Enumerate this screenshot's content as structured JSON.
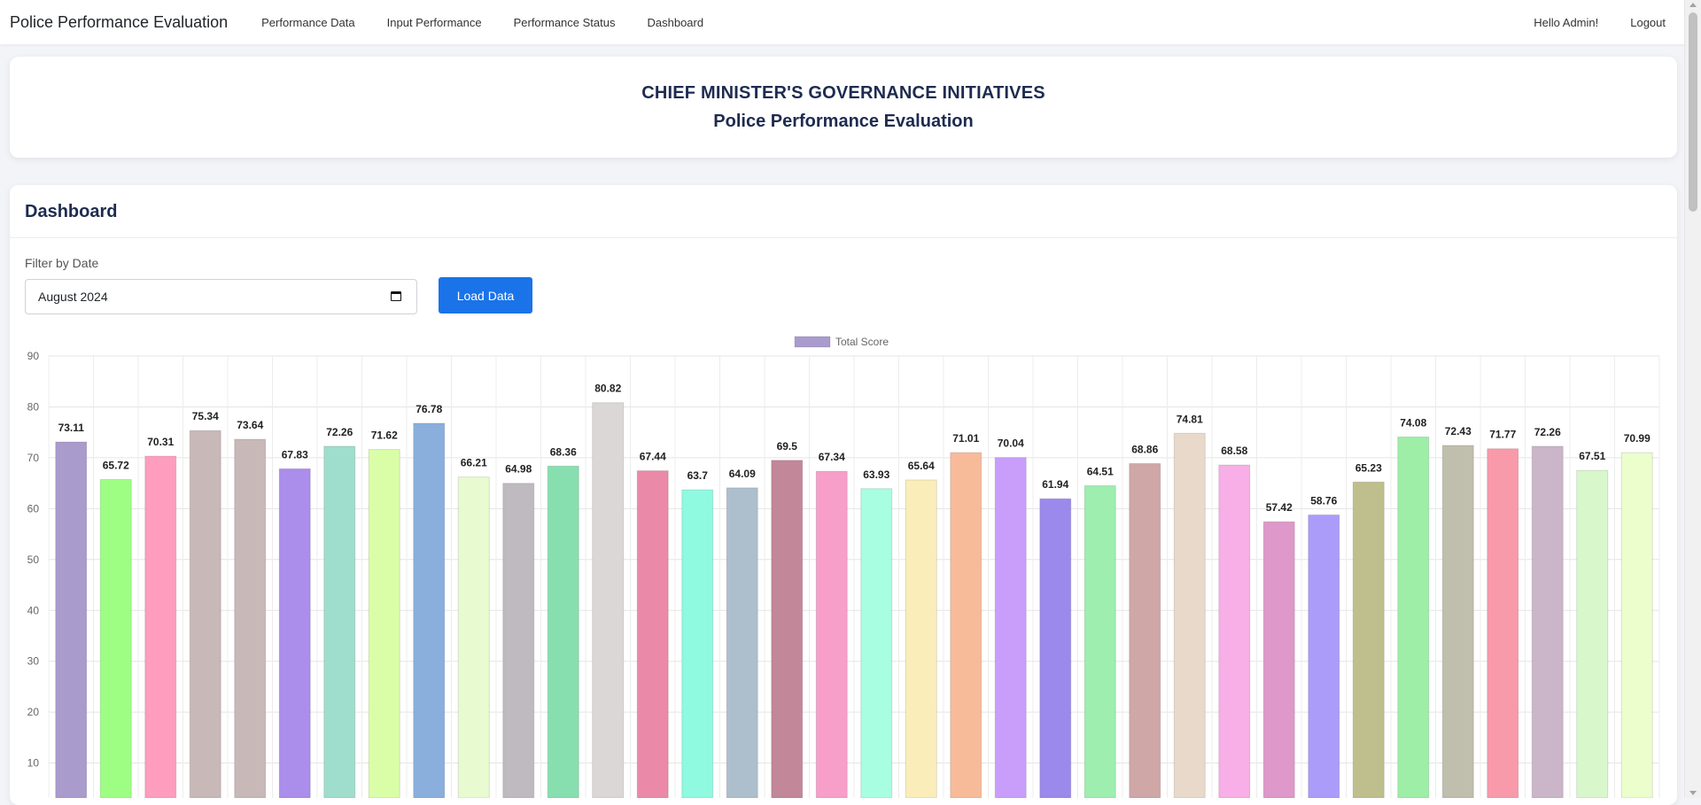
{
  "nav": {
    "brand": "Police Performance Evaluation",
    "links": [
      "Performance Data",
      "Input Performance",
      "Performance Status",
      "Dashboard"
    ],
    "greeting": "Hello Admin!",
    "logout": "Logout"
  },
  "header": {
    "title": "CHIEF MINISTER'S GOVERNANCE INITIATIVES",
    "subtitle": "Police Performance Evaluation"
  },
  "dashboard": {
    "title": "Dashboard",
    "filter_label": "Filter by Date",
    "date_value": "August 2024",
    "load_button": "Load Data"
  },
  "chart_data": {
    "type": "bar",
    "legend_position": "top-center",
    "grid": true,
    "ylim": [
      0,
      90
    ],
    "yticks": [
      10,
      20,
      30,
      40,
      50,
      60,
      70,
      80,
      90
    ],
    "series": [
      {
        "name": "Total Score",
        "legend_color": "#a99ccd",
        "values": [
          73.11,
          65.72,
          70.31,
          75.34,
          73.64,
          67.83,
          72.26,
          71.62,
          76.78,
          66.21,
          64.98,
          68.36,
          80.82,
          67.44,
          63.7,
          64.09,
          69.5,
          67.34,
          63.93,
          65.64,
          71.01,
          70.04,
          61.94,
          64.51,
          68.86,
          74.81,
          68.58,
          57.42,
          58.76,
          65.23,
          74.08,
          72.43,
          71.77,
          72.26,
          67.51,
          70.99
        ],
        "colors": [
          "#a99ccd",
          "#9efe84",
          "#fe9dbd",
          "#c9b8b8",
          "#c9b8b8",
          "#ab8dec",
          "#9fdecc",
          "#dafea8",
          "#8aafdc",
          "#e8fbd0",
          "#bfbac0",
          "#87dfaf",
          "#dcd7d7",
          "#ea8aa8",
          "#8ffae0",
          "#adbfcc",
          "#c28799",
          "#f89fc9",
          "#a8fee1",
          "#fbedba",
          "#f8bb9a",
          "#c99efb",
          "#9b8aeb",
          "#9eeeaf",
          "#cfa7a7",
          "#e8d9ca",
          "#f8aee6",
          "#de98c9",
          "#ac9cfa",
          "#bfbf8e",
          "#9eeea8",
          "#c0beac",
          "#f89aa9",
          "#cbb5c9",
          "#d8f8cc",
          "#ebfecc"
        ]
      }
    ]
  }
}
